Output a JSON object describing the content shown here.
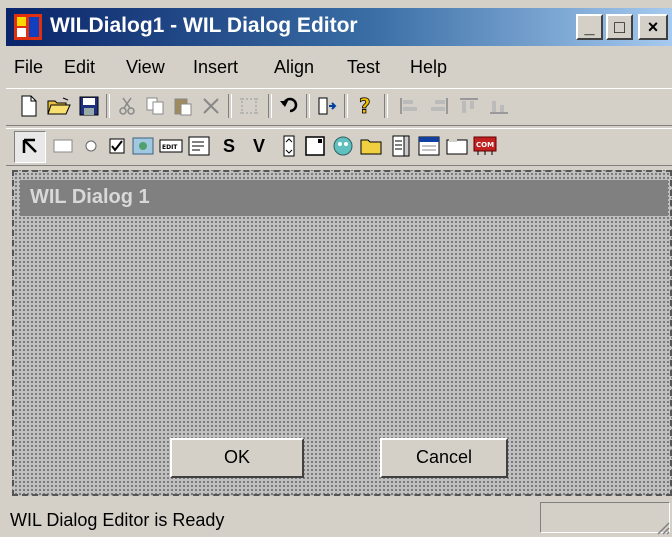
{
  "window": {
    "title": "WILDialog1 - WIL Dialog Editor",
    "controls": {
      "minimize": "_",
      "maximize": "□",
      "close": "×"
    }
  },
  "menubar": {
    "items": [
      {
        "label": "File"
      },
      {
        "label": "Edit"
      },
      {
        "label": "View"
      },
      {
        "label": "Insert"
      },
      {
        "label": "Align"
      },
      {
        "label": "Test"
      },
      {
        "label": "Help"
      }
    ]
  },
  "toolbar_main": {
    "tools": [
      "new-file-icon",
      "open-folder-icon",
      "save-icon",
      "cut-icon",
      "copy-icon",
      "paste-icon",
      "delete-icon",
      "select-bounds-icon",
      "undo-icon",
      "insert-control-icon",
      "help-icon",
      "align-left-icon",
      "align-right-icon",
      "align-top-icon",
      "align-bottom-icon"
    ]
  },
  "toolbar_controls": {
    "tools": [
      "pointer-icon",
      "groupbox-icon",
      "radio-icon",
      "checkbox-icon",
      "picture-icon",
      "edit-box-icon",
      "multiline-edit-icon",
      "static-text-icon",
      "variable-text-icon",
      "spinner-icon",
      "frame-icon",
      "picture-button-icon",
      "folder-icon",
      "list-box-icon",
      "menu-bar-icon",
      "group-frame-icon",
      "com-control-icon"
    ],
    "static_text_label": "S",
    "variable_text_label": "V",
    "edit_label": "EDIT",
    "com_label": "COM"
  },
  "dialog": {
    "caption": "WIL Dialog 1",
    "ok_label": "OK",
    "cancel_label": "Cancel"
  },
  "statusbar": {
    "text": "WIL Dialog Editor is Ready"
  },
  "colors": {
    "title_gradient_start": "#0a246a",
    "title_gradient_end": "#a6caf0",
    "face": "#d4d0c8",
    "dialog_caption": "#808080"
  }
}
